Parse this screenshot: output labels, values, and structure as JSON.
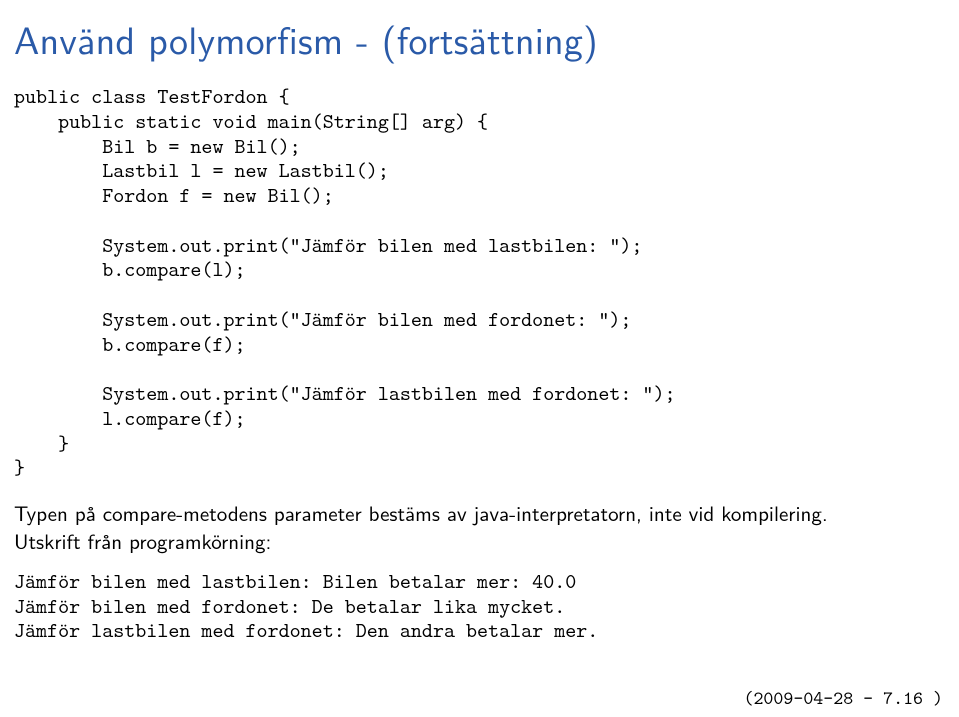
{
  "title": "Använd polymorfism - (fortsättning)",
  "code": "public class TestFordon {\n    public static void main(String[] arg) {\n        Bil b = new Bil();\n        Lastbil l = new Lastbil();\n        Fordon f = new Bil();\n\n        System.out.print(\"Jämför bilen med lastbilen: \");\n        b.compare(l);\n\n        System.out.print(\"Jämför bilen med fordonet: \");\n        b.compare(f);\n\n        System.out.print(\"Jämför lastbilen med fordonet: \");\n        l.compare(f);\n    }\n}",
  "body": {
    "line1": "Typen på compare-metodens parameter bestäms av java-interpretatorn, inte vid kompilering.",
    "line2": "Utskrift från programkörning:"
  },
  "output": "Jämför bilen med lastbilen: Bilen betalar mer: 40.0\nJämför bilen med fordonet: De betalar lika mycket.\nJämför lastbilen med fordonet: Den andra betalar mer.",
  "footer": "(2009-04-28 – 7.16 )"
}
